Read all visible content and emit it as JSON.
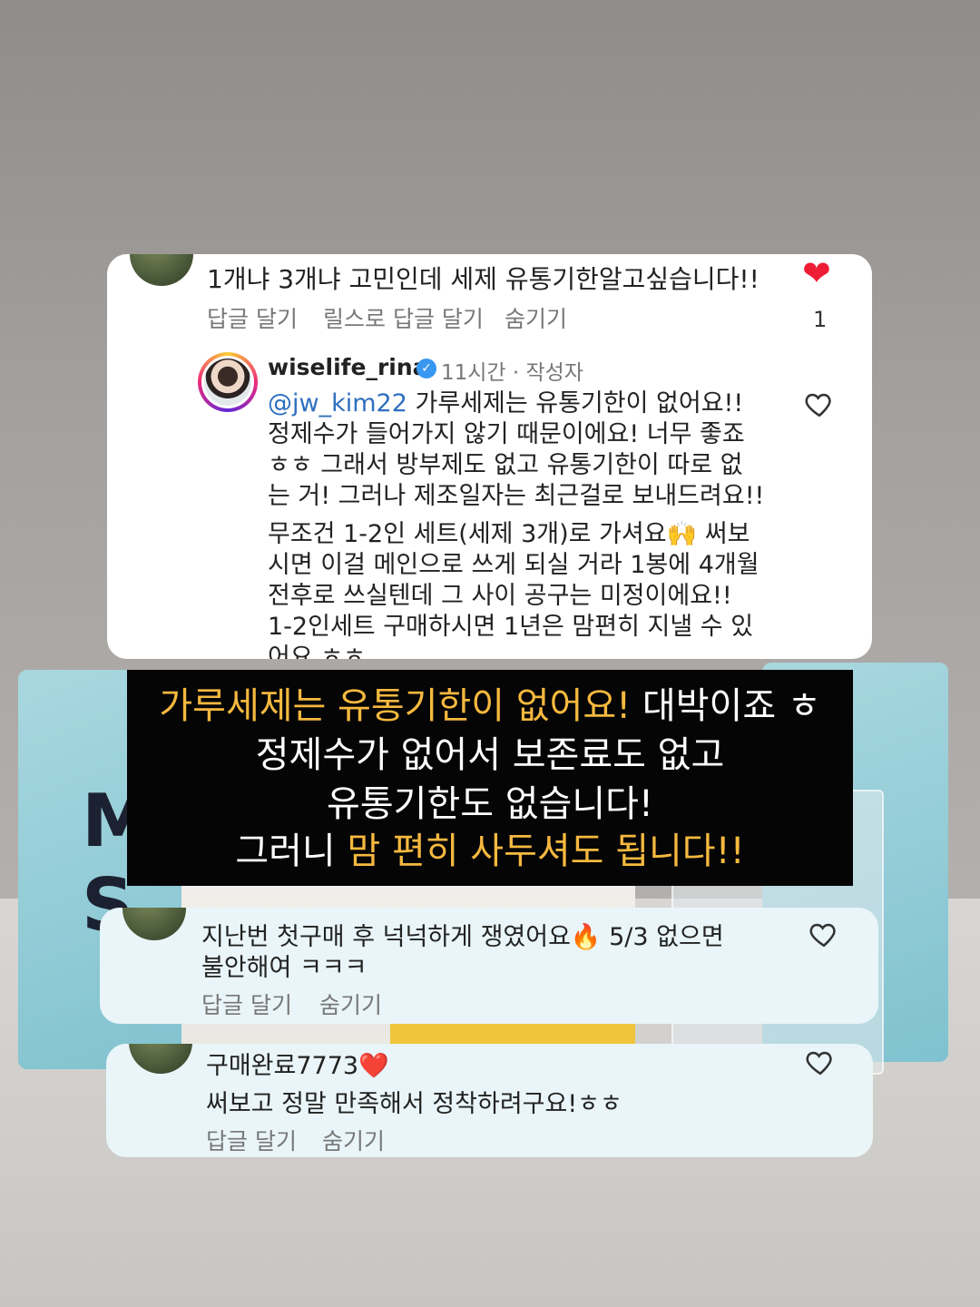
{
  "comment1": {
    "text": "1개냐 3개냐 고민인데 세제 유통기한알고싶습니다!!",
    "actions": [
      "답글 달기",
      "릴스로 답글 달기",
      "숨기기"
    ],
    "like_count": "1"
  },
  "reply": {
    "username": "wiselife_rina",
    "meta": "11시간 · 작성자",
    "mention": "@jw_kim22",
    "paragraph1": " 가루세제는 유통기한이 없어요!!\n정제수가 들어가지 않기 때문이에요! 너무 좋죠\nㅎㅎ 그래서 방부제도 없고 유통기한이 따로 없\n는 거! 그러나 제조일자는 최근걸로 보내드려요!!",
    "paragraph2": "무조건 1-2인 세트(세제 3개)로 가셔요🙌 써보\n시면 이걸 메인으로 쓰게 되실 거라 1봉에 4개월\n전후로 쓰실텐데 그 사이 공구는 미정이에요!!\n1-2인세트 구매하시면 1년은 맘편히 지낼 수 있\n어요 ㅎㅎ"
  },
  "caption": {
    "line1_yellow": "가루세제는 유통기한이 없어요!",
    "line1_white": " 대박이죠 ㅎ",
    "line2": "정제수가 없어서 보존료도 없고",
    "line3": "유통기한도 없습니다!",
    "line4_white": "그러니 ",
    "line4_yellow": "맘 편히 사두셔도 됩니다!!"
  },
  "comment2": {
    "line1": "지난번 첫구매 후 넉넉하게 쟁였어요🔥 5/3 없으면",
    "line2": "불안해여 ㅋㅋㅋ",
    "actions": [
      "답글 달기",
      "숨기기"
    ]
  },
  "comment3": {
    "username": "구매완료7773❤️",
    "text": "써보고 정말 만족해서 정착하려구요!ㅎㅎ",
    "actions": [
      "답글 달기",
      "숨기기"
    ]
  },
  "colors": {
    "heart_red": "#ee1d36",
    "caption_yellow": "#f6b93f",
    "mention_blue": "#2e6fbf"
  }
}
